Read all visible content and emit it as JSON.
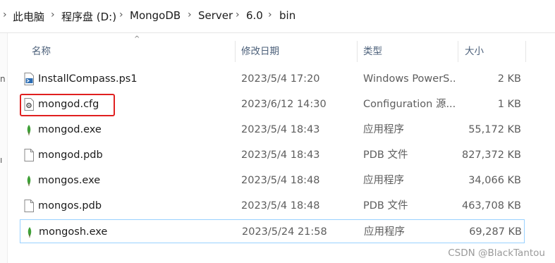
{
  "breadcrumb": {
    "items": [
      "此电脑",
      "程序盘 (D:)",
      "MongoDB",
      "Server",
      "6.0",
      "bin"
    ],
    "separator": "›"
  },
  "columns": {
    "name": "名称",
    "modified": "修改日期",
    "type": "类型",
    "size": "大小"
  },
  "files": [
    {
      "name": "InstallCompass.ps1",
      "modified": "2023/5/4 17:20",
      "type": "Windows PowerS...",
      "size": "2 KB",
      "icon": "powershell-script-icon"
    },
    {
      "name": "mongod.cfg",
      "modified": "2023/6/12 14:30",
      "type": "Configuration 源...",
      "size": "1 KB",
      "icon": "config-file-icon"
    },
    {
      "name": "mongod.exe",
      "modified": "2023/5/4 18:43",
      "type": "应用程序",
      "size": "55,172 KB",
      "icon": "mongodb-leaf-icon"
    },
    {
      "name": "mongod.pdb",
      "modified": "2023/5/4 18:43",
      "type": "PDB 文件",
      "size": "827,372 KB",
      "icon": "blank-file-icon"
    },
    {
      "name": "mongos.exe",
      "modified": "2023/5/4 18:48",
      "type": "应用程序",
      "size": "34,066 KB",
      "icon": "mongodb-leaf-icon"
    },
    {
      "name": "mongos.pdb",
      "modified": "2023/5/4 18:48",
      "type": "PDB 文件",
      "size": "463,708 KB",
      "icon": "blank-file-icon"
    },
    {
      "name": "mongosh.exe",
      "modified": "2023/5/24 21:58",
      "type": "应用程序",
      "size": "69,287 KB",
      "icon": "mongodb-leaf-icon"
    }
  ],
  "watermark": "CSDN @BlackTantou",
  "colors": {
    "highlight": "#e02020",
    "leaf": "#3fa037",
    "selection_border": "#99d1ff"
  }
}
